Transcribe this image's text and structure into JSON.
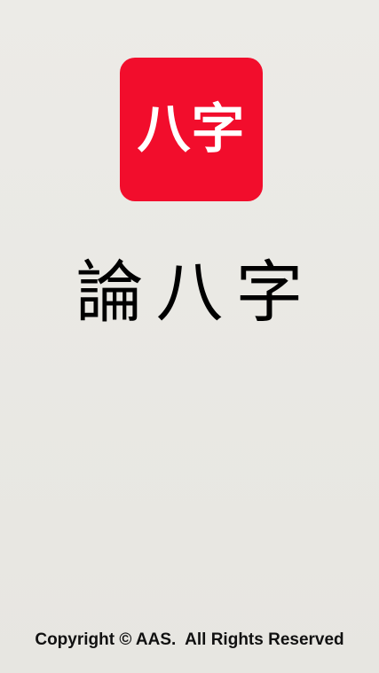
{
  "splash": {
    "icon_text": "八字",
    "title": "論八字",
    "copyright": "Copyright © AAS.  All Rights Reserved"
  },
  "colors": {
    "background": "#e9e8e4",
    "icon_background": "#f20d2c",
    "icon_text": "#ffffff",
    "title_text": "#000000"
  }
}
